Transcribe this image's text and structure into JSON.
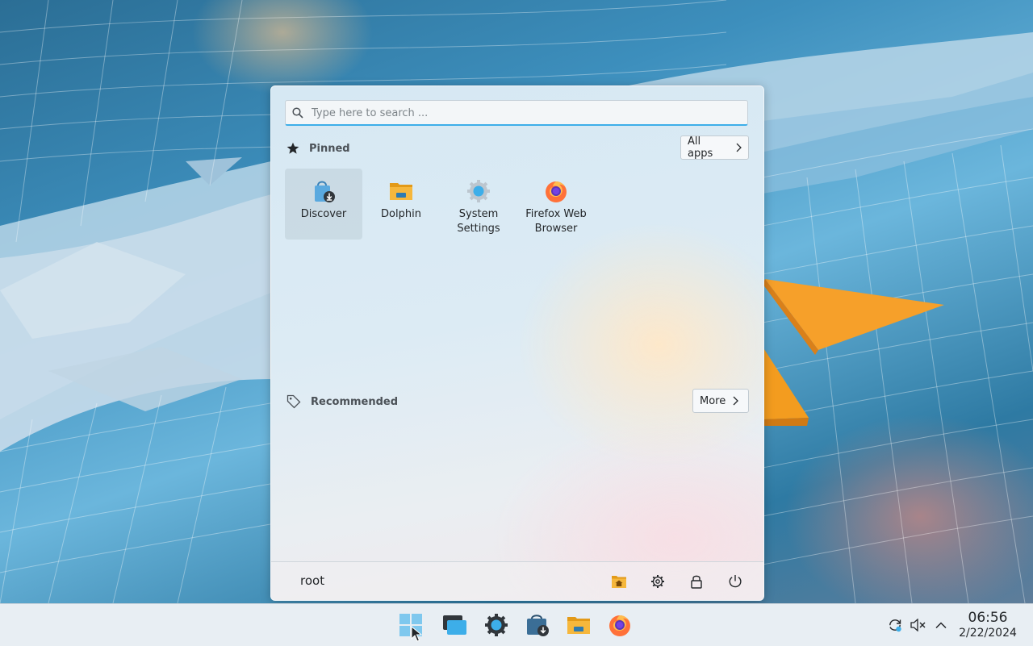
{
  "search": {
    "placeholder": "Type here to search ..."
  },
  "pinned": {
    "title": "Pinned",
    "all_apps_label": "All apps",
    "apps": [
      {
        "name": "Discover",
        "icon": "discover-icon",
        "selected": true
      },
      {
        "name": "Dolphin",
        "icon": "dolphin-folder-icon"
      },
      {
        "name": "System Settings",
        "icon": "system-settings-icon"
      },
      {
        "name": "Firefox Web Browser",
        "icon": "firefox-icon"
      }
    ]
  },
  "recommended": {
    "title": "Recommended",
    "more_label": "More"
  },
  "footer": {
    "user": "root",
    "buttons": [
      "home-folder-icon",
      "settings-gear-icon",
      "lock-icon",
      "power-icon"
    ]
  },
  "taskbar": {
    "items": [
      "start-menu-icon",
      "window-overview-icon",
      "system-settings-icon",
      "discover-icon",
      "dolphin-folder-icon",
      "firefox-icon"
    ],
    "tray": [
      "update-icon",
      "volume-muted-icon",
      "chevron-up-icon"
    ],
    "clock_time": "06:56",
    "clock_date": "2/22/2024"
  },
  "colors": {
    "accent": "#3daee9",
    "folder": "#f6b73c",
    "orange": "#f39c1f"
  }
}
